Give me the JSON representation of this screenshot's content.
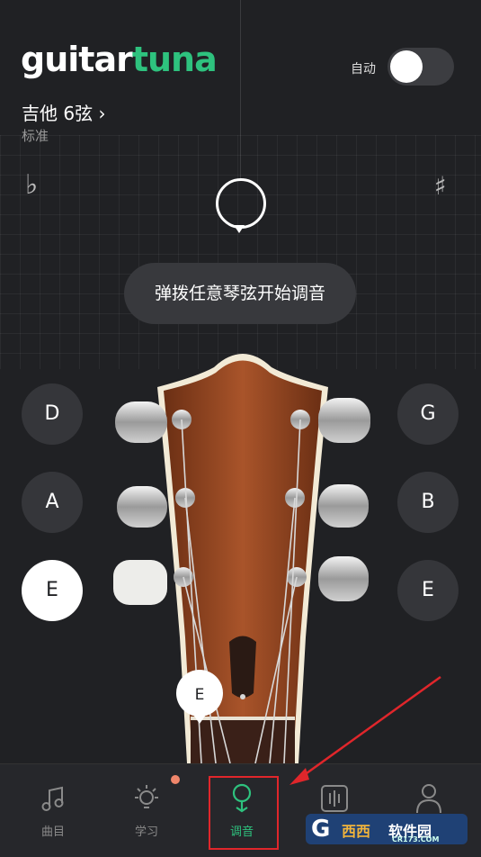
{
  "header": {
    "logo_part1": "guitar",
    "logo_part2": "tuna",
    "auto_label": "自动",
    "auto_enabled": false,
    "instrument": "吉他 6弦",
    "instrument_chevron": "›",
    "tuning": "标准"
  },
  "meter": {
    "flat_symbol": "♭",
    "sharp_symbol": "♯"
  },
  "hint": "弹拨任意琴弦开始调音",
  "strings_left": [
    "D",
    "A",
    "E"
  ],
  "strings_right": [
    "G",
    "B",
    "E"
  ],
  "selected_string": "E",
  "colors": {
    "accent": "#2ec27e",
    "background": "#202124",
    "notification": "#f0866b",
    "annotation": "#e0262b"
  },
  "tabs": [
    {
      "label": "曲目",
      "icon": "music-note-icon"
    },
    {
      "label": "学习",
      "icon": "lightbulb-icon"
    },
    {
      "label": "调音",
      "icon": "tuner-icon",
      "active": true
    },
    {
      "label": "",
      "icon": "equalizer-icon"
    },
    {
      "label": "",
      "icon": "profile-icon"
    }
  ],
  "watermark": {
    "mark": "G",
    "brand": "西西",
    "product": "软件园",
    "domain": "CR173.COM"
  }
}
